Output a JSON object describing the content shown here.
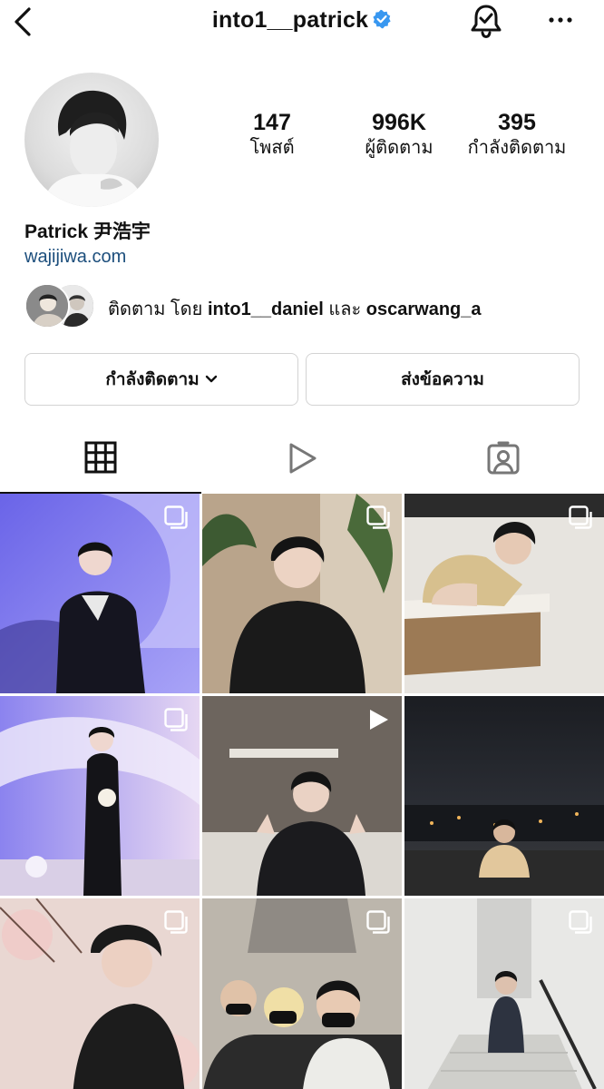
{
  "header": {
    "username": "into1__patrick",
    "back_icon": "chevron-left-icon",
    "verified_icon": "verified-badge-icon",
    "bell_icon": "bell-check-icon",
    "more_icon": "more-horizontal-icon"
  },
  "stats": [
    {
      "value": "147",
      "label": "โพสต์"
    },
    {
      "value": "996K",
      "label": "ผู้ติดตาม"
    },
    {
      "value": "395",
      "label": "กำลังติดตาม"
    }
  ],
  "profile": {
    "name": "Patrick 尹浩宇",
    "website": "wajijiwa.com"
  },
  "mutual": {
    "prefix": "ติดตาม โดย ",
    "user1": "into1__daniel",
    "joiner": " และ ",
    "user2": "oscarwang_a"
  },
  "buttons": {
    "following_label": "กำลังติดตาม",
    "message_label": "ส่งข้อความ"
  },
  "tabs": [
    {
      "icon": "grid-icon",
      "active": true
    },
    {
      "icon": "reels-play-icon",
      "active": false
    },
    {
      "icon": "tagged-person-icon",
      "active": false
    }
  ],
  "posts": [
    {
      "badge": "multi-photo-icon"
    },
    {
      "badge": "multi-photo-icon"
    },
    {
      "badge": "multi-photo-icon"
    },
    {
      "badge": "multi-photo-icon"
    },
    {
      "badge": "video-play-icon"
    },
    {
      "badge": "none"
    },
    {
      "badge": "multi-photo-icon"
    },
    {
      "badge": "multi-photo-icon"
    },
    {
      "badge": "multi-photo-icon"
    }
  ],
  "colors": {
    "link": "#1c4e7c",
    "verified": "#3897f0",
    "border": "#d3d3d3",
    "text": "#111111"
  }
}
